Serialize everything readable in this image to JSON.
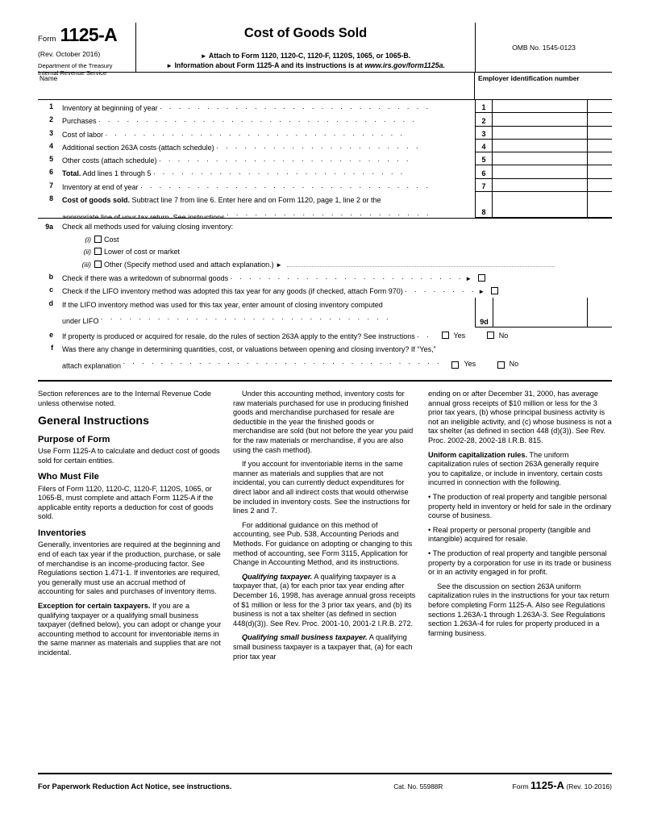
{
  "header": {
    "form_word": "Form",
    "form_number": "1125-A",
    "revision": "(Rev. October 2016)",
    "department_line1": "Department of the Treasury",
    "department_line2": "Internal Revenue Service",
    "title": "Cost of Goods Sold",
    "attach_line": "Attach to Form 1120, 1120-C, 1120-F, 1120S, 1065, or 1065-B.",
    "info_line_prefix": "Information about Form 1125-A and its instructions is at ",
    "info_line_url": "www.irs.gov/form1125a.",
    "omb": "OMB No. 1545-0123",
    "name_label": "Name",
    "ein_label": "Employer identification number",
    "name_value": "",
    "ein_value": ""
  },
  "lines": [
    {
      "num": "1",
      "box": "1",
      "text": "Inventory at beginning of year",
      "bold_lead": "",
      "value": "",
      "cents": ""
    },
    {
      "num": "2",
      "box": "2",
      "text": "Purchases",
      "bold_lead": "",
      "value": "",
      "cents": ""
    },
    {
      "num": "3",
      "box": "3",
      "text": "Cost of labor",
      "bold_lead": "",
      "value": "",
      "cents": ""
    },
    {
      "num": "4",
      "box": "4",
      "text": "Additional section 263A costs (attach schedule)",
      "bold_lead": "",
      "value": "",
      "cents": ""
    },
    {
      "num": "5",
      "box": "5",
      "text": "Other costs (attach schedule)",
      "bold_lead": "",
      "value": "",
      "cents": ""
    },
    {
      "num": "6",
      "box": "6",
      "text": "Add lines 1 through 5",
      "bold_lead": "Total.",
      "value": "",
      "cents": ""
    },
    {
      "num": "7",
      "box": "7",
      "text": "Inventory at end of year",
      "bold_lead": "",
      "value": "",
      "cents": ""
    }
  ],
  "line8": {
    "num": "8",
    "box": "8",
    "bold_lead": "Cost of goods sold.",
    "text_line1": "Subtract line 7 from line 6. Enter here and on Form 1120, page 1, line 2 or the",
    "text_line2": "appropriate line of your tax return. See instructions",
    "value": "",
    "cents": ""
  },
  "line9": {
    "a_num": "9a",
    "a_text": "Check all methods used for valuing closing inventory:",
    "methods": [
      {
        "roman": "(i)",
        "label": "Cost",
        "checked": false
      },
      {
        "roman": "(ii)",
        "label": "Lower of cost or market",
        "checked": false
      },
      {
        "roman": "(iii)",
        "label": "Other (Specify method used and attach explanation.)",
        "checked": false
      }
    ],
    "other_specify_value": "",
    "b_num": "b",
    "b_text": "Check if there was a writedown of subnormal goods",
    "b_checked": false,
    "c_num": "c",
    "c_text": "Check if the LIFO inventory method was adopted this tax year for any goods (if checked, attach Form 970)",
    "c_checked": false,
    "d_num": "d",
    "d_text_line1": "If the LIFO inventory method was used for this tax year, enter amount of closing inventory computed",
    "d_text_line2": "under LIFO",
    "d_box": "9d",
    "d_value": "",
    "d_cents": "",
    "e_num": "e",
    "e_text": "If property is produced or acquired for resale, do the rules of section 263A apply to the entity? See instructions",
    "e_yes": "Yes",
    "e_no": "No",
    "e_yes_checked": false,
    "e_no_checked": false,
    "f_num": "f",
    "f_text_line1": "Was there any change in determining quantities, cost, or valuations between opening and closing inventory? If “Yes,”",
    "f_text_line2": "attach explanation",
    "f_yes": "Yes",
    "f_no": "No",
    "f_yes_checked": false,
    "f_no_checked": false
  },
  "instructions": {
    "col1": {
      "intro": "Section references are to the Internal Revenue Code unless otherwise noted.",
      "h_general": "General Instructions",
      "h_purpose": "Purpose of Form",
      "purpose_body": "Use Form 1125-A to calculate and deduct cost of goods sold for certain entities.",
      "h_who": "Who Must File",
      "who_body": "Filers of Form 1120, 1120-C, 1120-F, 1120S, 1065, or 1065-B, must complete and attach Form 1125-A if the applicable entity reports a deduction for cost of goods sold.",
      "h_inventories": "Inventories",
      "inv_body": "Generally, inventories are required at the beginning and end of each tax year if the production, purchase, or sale of merchandise is an income-producing factor. See Regulations section 1.471-1. If inventories are required, you generally must use an accrual method of accounting for sales and purchases of inventory items.",
      "exception_lead": "Exception for certain taxpayers.",
      "exception_body": " If you are a qualifying taxpayer or a qualifying small business taxpayer (defined below), you can adopt or change your accounting method to account for inventoriable items in the same manner as materials and supplies that are not incidental."
    },
    "col2": {
      "p1": "Under this accounting method, inventory costs for raw materials purchased for use in producing finished goods and merchandise purchased for resale are deductible in the year the finished goods or merchandise are sold (but not before the year you paid for the raw materials or merchandise, if you are also using the cash method).",
      "p2": "If you account for inventoriable items in the same manner as materials and supplies that are not incidental, you can currently deduct expenditures for direct labor and all indirect costs that would otherwise be included in inventory costs. See the instructions for lines 2 and 7.",
      "p3": "For additional guidance on this method of accounting, see Pub. 538, Accounting Periods and Methods. For guidance on adopting or changing to this method of accounting, see Form 3115, Application for Change in Accounting Method, and its instructions.",
      "qual_lead": "Qualifying taxpayer.",
      "qual_body": " A qualifying taxpayer is a taxpayer that, (a) for each prior tax year ending after December 16, 1998, has average annual gross receipts of $1 million or less for the 3 prior tax years, and (b) its business is not a tax shelter (as defined in section 448(d)(3)). See Rev. Proc. 2001-10, 2001-2 I.R.B. 272.",
      "qsbt_lead": "Qualifying small business taxpayer.",
      "qsbt_body": " A qualifying small business taxpayer is a taxpayer that, (a) for each prior tax year"
    },
    "col3": {
      "p1": "ending on or after December 31, 2000, has average annual gross receipts of $10 million or less for the 3 prior tax years, (b) whose principal business activity is not an ineligible activity, and (c) whose business is not a tax shelter (as defined in section 448 (d)(3)). See Rev. Proc. 2002-28, 2002-18 I.R.B. 815.",
      "ucr_lead": "Uniform capitalization rules.",
      "ucr_body": " The uniform capitalization rules of section 263A generally require you to capitalize, or include in inventory, certain costs incurred in connection with the following.",
      "bullet1": "• The production of real property and tangible personal property held in inventory or held for sale in the ordinary course of business.",
      "bullet2": "• Real property or personal property (tangible and intangible) acquired for resale.",
      "bullet3": "• The production of real property and tangible personal property by a corporation for use in its trade or business or in an activity engaged in for profit.",
      "p_last": "See the discussion on section 263A uniform capitalization rules in the instructions for your tax return before completing Form 1125-A. Also see Regulations sections 1.263A-1 through 1.263A-3. See Regulations section 1.263A-4 for rules for property produced in a farming business."
    }
  },
  "footer": {
    "paperwork": "For Paperwork Reduction Act Notice, see instructions.",
    "cat_no": "Cat. No. 55988R",
    "form_word": "Form",
    "form_number": "1125-A",
    "revision": "(Rev. 10-2016)"
  }
}
